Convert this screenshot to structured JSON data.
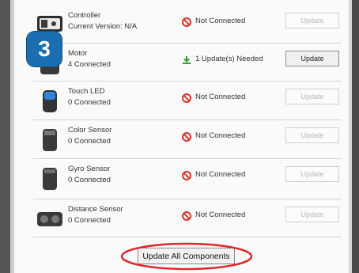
{
  "components": [
    {
      "name": "Controller",
      "status": "Current Version: N/A",
      "connection": "Not Connected",
      "connection_state": "error",
      "update_label": "Update",
      "update_enabled": false,
      "icon": "controller-icon"
    },
    {
      "name": "Motor",
      "status": "4 Connected",
      "connection": "1 Update(s) Needed",
      "connection_state": "update",
      "update_label": "Update",
      "update_enabled": true,
      "icon": "motor-icon"
    },
    {
      "name": "Touch LED",
      "status": "0 Connected",
      "connection": "Not Connected",
      "connection_state": "error",
      "update_label": "Update",
      "update_enabled": false,
      "icon": "touch-led-icon"
    },
    {
      "name": "Color Sensor",
      "status": "0 Connected",
      "connection": "Not Connected",
      "connection_state": "error",
      "update_label": "Update",
      "update_enabled": false,
      "icon": "color-sensor-icon"
    },
    {
      "name": "Gyro Sensor",
      "status": "0 Connected",
      "connection": "Not Connected",
      "connection_state": "error",
      "update_label": "Update",
      "update_enabled": false,
      "icon": "gyro-sensor-icon"
    },
    {
      "name": "Distance Sensor",
      "status": "0 Connected",
      "connection": "Not Connected",
      "connection_state": "error",
      "update_label": "Update",
      "update_enabled": false,
      "icon": "distance-sensor-icon"
    }
  ],
  "step_badge": "3",
  "update_all_label": "Update All Components",
  "colors": {
    "error": "#d9342b",
    "update_arrow": "#3a9c3a",
    "badge": "#1b6fb0",
    "highlight": "#e3262b"
  }
}
